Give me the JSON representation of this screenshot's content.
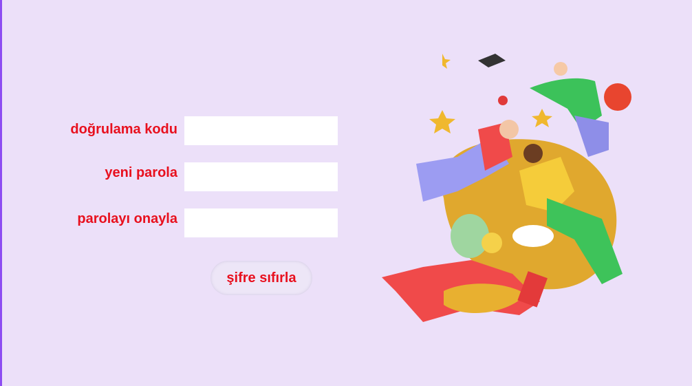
{
  "form": {
    "fields": [
      {
        "label": "doğrulama kodu",
        "value": ""
      },
      {
        "label": "yeni parola",
        "value": ""
      },
      {
        "label": "parolayı onayla",
        "value": ""
      }
    ],
    "submit_label": "şifre sıfırla"
  },
  "colors": {
    "background": "#ece0f9",
    "accent_border": "#8c4cf2",
    "label": "#e8101e"
  },
  "illustration": "students-flying-education-illustration"
}
